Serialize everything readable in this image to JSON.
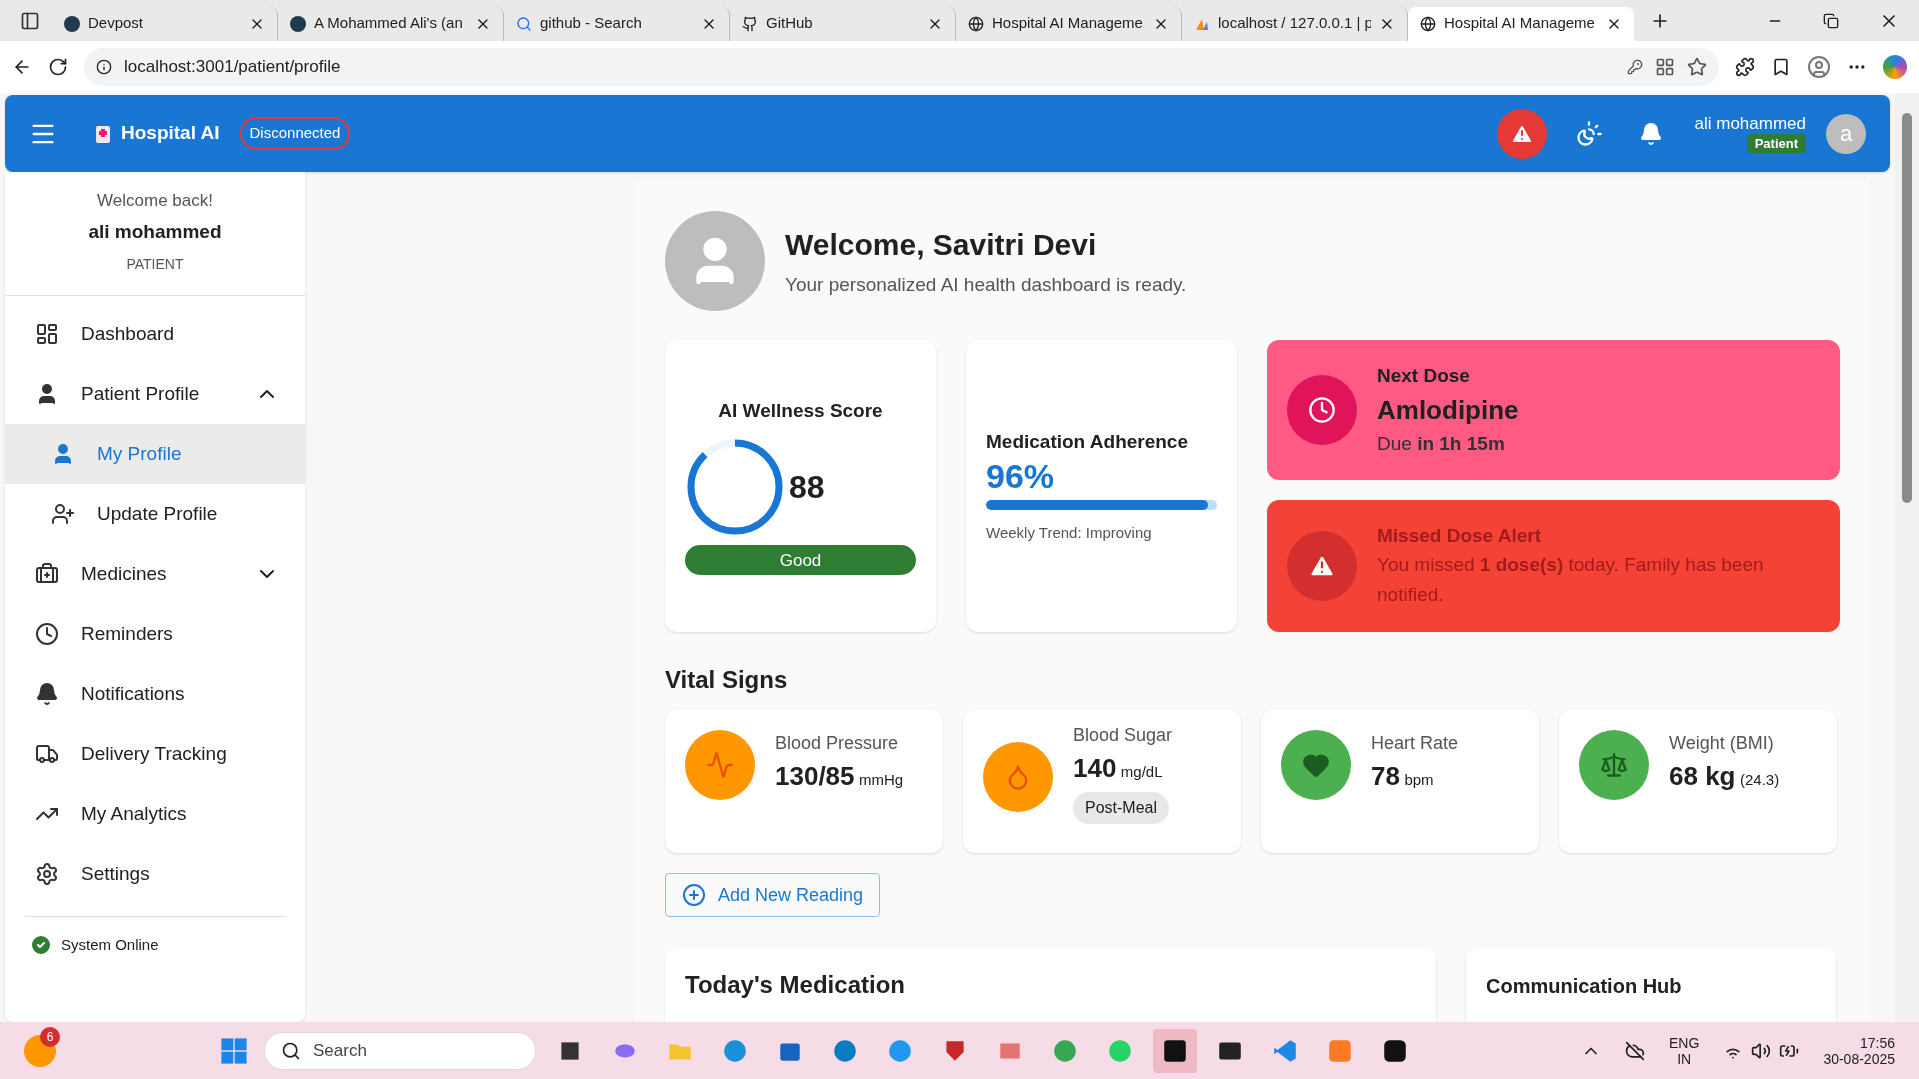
{
  "browser": {
    "tabs": [
      {
        "title": "Devpost",
        "kind": "d",
        "selected": false
      },
      {
        "title": "A Mohammed Ali's (an",
        "kind": "d",
        "selected": false
      },
      {
        "title": "github - Search",
        "kind": "search",
        "selected": false
      },
      {
        "title": "GitHub",
        "kind": "github",
        "selected": false
      },
      {
        "title": "Hospital AI Manageme",
        "kind": "globe",
        "selected": false
      },
      {
        "title": "localhost / 127.0.0.1 | p",
        "kind": "pma",
        "selected": false
      },
      {
        "title": "Hospital AI Manageme",
        "kind": "globe",
        "selected": true
      }
    ],
    "url": "localhost:3001/patient/profile"
  },
  "header": {
    "app_title": "Hospital AI",
    "connection_status": "Disconnected",
    "user_name": "ali mohammed",
    "user_role": "Patient",
    "avatar_letter": "a"
  },
  "sidebar": {
    "greeting": "Welcome back!",
    "user_name": "ali mohammed",
    "user_role": "PATIENT",
    "items": [
      {
        "kind": "dashboard",
        "label": "Dashboard",
        "selected": false
      },
      {
        "kind": "person",
        "label": "Patient Profile",
        "selected": false,
        "expanded": true,
        "children": [
          {
            "kind": "person",
            "label": "My Profile",
            "selected": true
          },
          {
            "kind": "person-add",
            "label": "Update Profile",
            "selected": false
          }
        ]
      },
      {
        "kind": "medicine",
        "label": "Medicines",
        "selected": false,
        "expanded": false
      },
      {
        "kind": "clock",
        "label": "Reminders",
        "selected": false
      },
      {
        "kind": "bell",
        "label": "Notifications",
        "selected": false
      },
      {
        "kind": "truck",
        "label": "Delivery Tracking",
        "selected": false
      },
      {
        "kind": "trend",
        "label": "My Analytics",
        "selected": false
      },
      {
        "kind": "gear",
        "label": "Settings",
        "selected": false
      }
    ],
    "status": "System Online"
  },
  "welcome": {
    "title": "Welcome, Savitri Devi",
    "subtitle": "Your personalized AI health dashboard is ready."
  },
  "wellness": {
    "title": "AI Wellness Score",
    "score": "88",
    "level": 0.88,
    "rating": "Good"
  },
  "adherence": {
    "title": "Medication Adherence",
    "value": "96%",
    "level": 0.96,
    "trend": "Weekly Trend: Improving"
  },
  "next_dose": {
    "label": "Next Dose",
    "medicine": "Amlodipine",
    "due": "Due **in 1h 15m**"
  },
  "missed_dose": {
    "title": "Missed Dose Alert",
    "message": "You missed **1 dose(s)** today. Family has been notified."
  },
  "vital_signs": {
    "title": "Vital Signs",
    "items": [
      {
        "kind": "pressure",
        "label": "Blood Pressure",
        "value": "130/85",
        "unit": "mmHg",
        "color": "#ff9800"
      },
      {
        "kind": "sugar",
        "label": "Blood Sugar",
        "value": "140",
        "unit": "mg/dL",
        "tag": "Post-Meal",
        "color": "#ff9800"
      },
      {
        "kind": "heart",
        "label": "Heart Rate",
        "value": "78",
        "unit": "bpm",
        "color": "#4caf50"
      },
      {
        "kind": "weight",
        "label": "Weight (BMI)",
        "value": "68 kg",
        "unit": "(24.3)",
        "color": "#4caf50"
      }
    ],
    "add_button": "Add New Reading"
  },
  "todays_medication": {
    "title": "Today's Medication"
  },
  "communication_hub": {
    "title": "Communication Hub"
  },
  "taskbar": {
    "weather_badge": "6",
    "search_placeholder": "Search",
    "language": "ENG",
    "region": "IN",
    "time": "17:56",
    "date": "30-08-2025"
  }
}
